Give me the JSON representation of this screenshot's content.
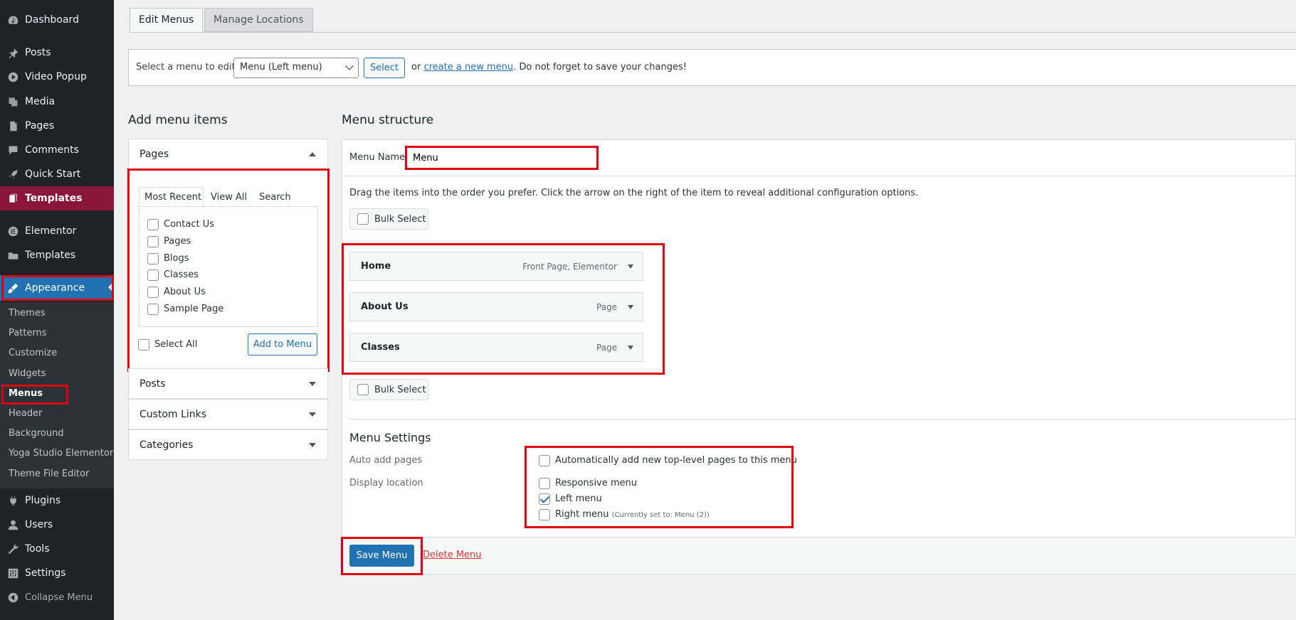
{
  "sidebar": {
    "items": [
      {
        "label": "Dashboard",
        "icon": "dashboard-icon"
      },
      {
        "label": "Posts",
        "icon": "pin-icon"
      },
      {
        "label": "Video Popup",
        "icon": "play-icon"
      },
      {
        "label": "Media",
        "icon": "media-icon"
      },
      {
        "label": "Pages",
        "icon": "page-icon"
      },
      {
        "label": "Comments",
        "icon": "comment-icon"
      },
      {
        "label": "Quick Start",
        "icon": "rocket-icon"
      },
      {
        "label": "Templates",
        "icon": "template-icon"
      },
      {
        "label": "Elementor",
        "icon": "elementor-icon"
      },
      {
        "label": "Templates",
        "icon": "folder-icon"
      },
      {
        "label": "Appearance",
        "icon": "brush-icon"
      },
      {
        "label": "Plugins",
        "icon": "plugin-icon"
      },
      {
        "label": "Users",
        "icon": "user-icon"
      },
      {
        "label": "Tools",
        "icon": "wrench-icon"
      },
      {
        "label": "Settings",
        "icon": "settings-icon"
      },
      {
        "label": "Collapse Menu",
        "icon": "collapse-icon"
      }
    ],
    "appearance_sub": [
      "Themes",
      "Patterns",
      "Customize",
      "Widgets",
      "Menus",
      "Header",
      "Background",
      "Yoga Studio Elementor",
      "Theme File Editor"
    ]
  },
  "tabs": {
    "edit": "Edit Menus",
    "manage": "Manage Locations"
  },
  "select_bar": {
    "label": "Select a menu to edit:",
    "selected": "Menu (Left menu)",
    "select_button": "Select",
    "or": "or",
    "create_link": "create a new menu",
    "suffix": ". Do not forget to save your changes!"
  },
  "add_items": {
    "heading": "Add menu items",
    "pages_title": "Pages",
    "tabs": [
      "Most Recent",
      "View All",
      "Search"
    ],
    "pages": [
      "Contact Us",
      "Pages",
      "Blogs",
      "Classes",
      "About Us",
      "Sample Page"
    ],
    "select_all": "Select All",
    "add_button": "Add to Menu",
    "sections": [
      "Posts",
      "Custom Links",
      "Categories"
    ]
  },
  "structure": {
    "heading": "Menu structure",
    "name_label": "Menu Name",
    "name_value": "Menu",
    "instructions": "Drag the items into the order you prefer. Click the arrow on the right of the item to reveal additional configuration options.",
    "bulk_select": "Bulk Select",
    "items": [
      {
        "title": "Home",
        "type": "Front Page, Elementor"
      },
      {
        "title": "About Us",
        "type": "Page"
      },
      {
        "title": "Classes",
        "type": "Page"
      }
    ]
  },
  "settings": {
    "heading": "Menu Settings",
    "auto_add_label": "Auto add pages",
    "auto_add_option": "Automatically add new top-level pages to this menu",
    "location_label": "Display location",
    "locations": [
      {
        "label": "Responsive menu",
        "checked": false
      },
      {
        "label": "Left menu",
        "checked": true
      },
      {
        "label": "Right menu",
        "checked": false,
        "note": "(Currently set to: Menu (2))"
      }
    ]
  },
  "actions": {
    "save": "Save Menu",
    "delete": "Delete Menu"
  },
  "colors": {
    "accent": "#2271b1",
    "sidebar": "#1d2327",
    "templates_active": "#8a1538",
    "highlight": "#e00012"
  }
}
